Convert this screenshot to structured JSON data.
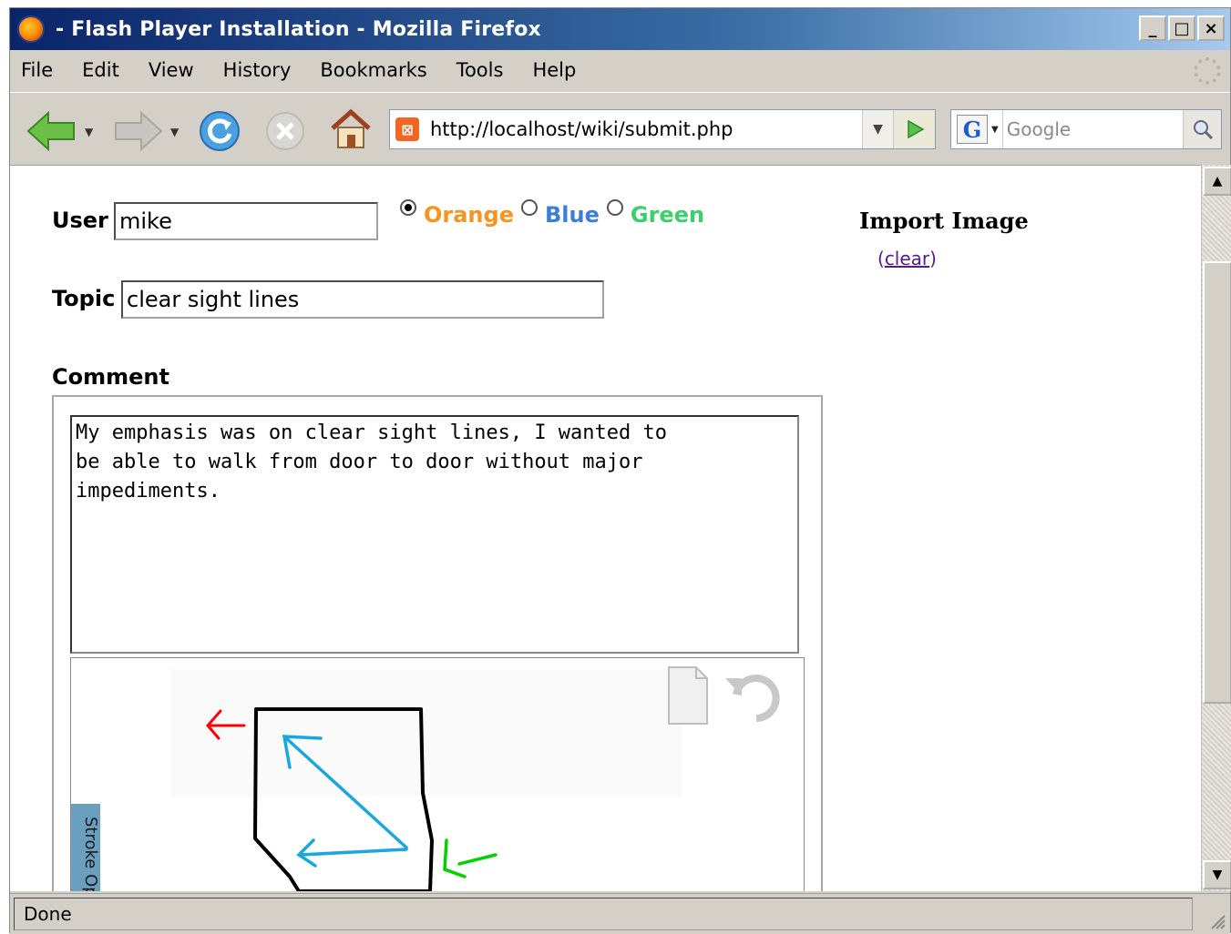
{
  "window": {
    "title": "- Flash Player Installation - Mozilla Firefox",
    "buttons": {
      "minimize": "_",
      "maximize": "□",
      "close": "×"
    }
  },
  "menu": {
    "items": [
      "File",
      "Edit",
      "View",
      "History",
      "Bookmarks",
      "Tools",
      "Help"
    ]
  },
  "toolbar": {
    "url": "http://localhost/wiki/submit.php",
    "site_icon_glyph": "⊠",
    "search_engine_glyph": "G",
    "search_placeholder": "Google"
  },
  "form": {
    "user_label": "User",
    "user_value": "mike",
    "color_options": [
      {
        "label": "Orange",
        "color": "#f7931e",
        "checked": true
      },
      {
        "label": "Blue",
        "color": "#3a7ed8",
        "checked": false
      },
      {
        "label": "Green",
        "color": "#3ccf6a",
        "checked": false
      }
    ],
    "topic_label": "Topic",
    "topic_value": "clear sight lines",
    "comment_label": "Comment",
    "comment_value": "My emphasis was on clear sight lines, I wanted to\nbe able to walk from door to door without major\nimpediments.",
    "stroke_tab_label": "Stroke Op"
  },
  "sidebar": {
    "import_title": "Import Image",
    "clear_open": "(",
    "clear_link": "clear",
    "clear_close": ")"
  },
  "status": {
    "text": "Done"
  },
  "colors": {
    "titlebar_start": "#0a246a",
    "chrome": "#d4d0c8",
    "red_arrow": "#ff0000",
    "blue_stroke": "#1aa7e0",
    "green_arrow": "#00d400"
  }
}
